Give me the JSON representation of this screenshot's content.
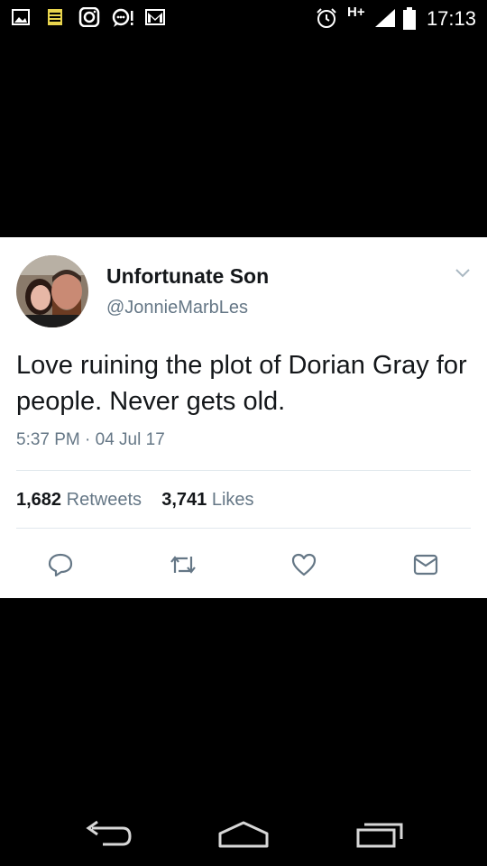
{
  "status_bar": {
    "network": "H+",
    "time": "17:13"
  },
  "tweet": {
    "display_name": "Unfortunate Son",
    "handle": "@JonnieMarbLes",
    "text": "Love ruining the plot of Dorian Gray for people. Never gets old.",
    "timestamp": "5:37 PM · 04 Jul 17",
    "retweets_count": "1,682",
    "retweets_label": "Retweets",
    "likes_count": "3,741",
    "likes_label": "Likes"
  },
  "icons": {
    "status_left": [
      "picture-icon",
      "notes-icon",
      "instagram-icon",
      "chat-alert-icon",
      "gmail-icon"
    ],
    "status_right": [
      "alarm-icon",
      "signal-icon",
      "battery-icon"
    ],
    "actions": [
      "reply-icon",
      "retweet-icon",
      "like-icon",
      "dm-icon"
    ],
    "nav": [
      "back-icon",
      "home-icon",
      "recents-icon"
    ]
  },
  "colors": {
    "text_primary": "#14171a",
    "text_secondary": "#657786",
    "divider": "#e1e8ed"
  }
}
